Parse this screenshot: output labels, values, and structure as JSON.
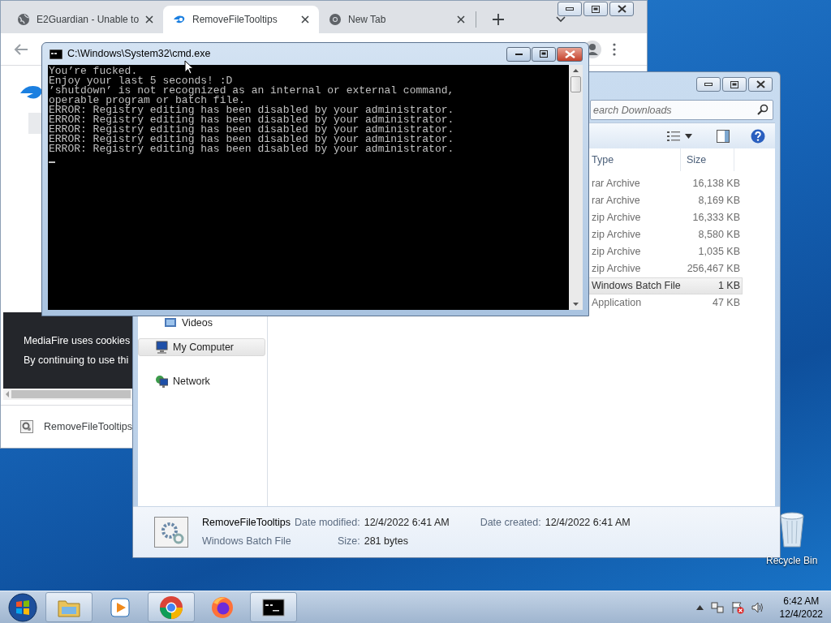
{
  "browser": {
    "tabs": [
      {
        "title": "E2Guardian - Unable to",
        "kind": "globe",
        "selected": false
      },
      {
        "title": "RemoveFileTooltips",
        "kind": "mediafire",
        "selected": true
      },
      {
        "title": "New Tab",
        "kind": "chrome",
        "selected": false
      }
    ],
    "cookie_banner": [
      "MediaFire uses cookies",
      "By continuing to use thi"
    ],
    "download_item": "RemoveFileTooltips"
  },
  "explorer": {
    "search": {
      "placeholder": "earch Downloads"
    },
    "nav_items": [
      {
        "label": "Videos",
        "kind": "library",
        "selected": false
      },
      {
        "label": "My Computer",
        "kind": "computer",
        "selected": true
      },
      {
        "label": "Network",
        "kind": "network",
        "selected": false
      }
    ],
    "columns": [
      "Type",
      "Size"
    ],
    "rows": [
      {
        "type": "rar Archive",
        "size": "16,138 KB",
        "selected": false
      },
      {
        "type": "rar Archive",
        "size": "8,169 KB",
        "selected": false
      },
      {
        "type": "zip Archive",
        "size": "16,333 KB",
        "selected": false
      },
      {
        "type": "zip Archive",
        "size": "8,580 KB",
        "selected": false
      },
      {
        "type": "zip Archive",
        "size": "1,035 KB",
        "selected": false
      },
      {
        "type": "zip Archive",
        "size": "256,467 KB",
        "selected": false
      },
      {
        "type": "Windows Batch File",
        "size": "1 KB",
        "selected": true
      },
      {
        "type": "Application",
        "size": "47 KB",
        "selected": false
      }
    ],
    "details": {
      "name": "RemoveFileTooltips",
      "type": "Windows Batch File",
      "fields": [
        {
          "label": "Date modified:",
          "value": "12/4/2022 6:41 AM"
        },
        {
          "label": "Date created:",
          "value": "12/4/2022 6:41 AM"
        },
        {
          "label": "Size:",
          "value": "281 bytes"
        }
      ]
    }
  },
  "cmd": {
    "title": "C:\\Windows\\System32\\cmd.exe",
    "lines": [
      "You’re fucked.",
      "Enjoy your last 5 seconds! :D",
      "’shutdown’ is not recognized as an internal or external command,",
      "operable program or batch file.",
      "ERROR: Registry editing has been disabled by your administrator.",
      "ERROR: Registry editing has been disabled by your administrator.",
      "ERROR: Registry editing has been disabled by your administrator.",
      "ERROR: Registry editing has been disabled by your administrator.",
      "ERROR: Registry editing has been disabled by your administrator."
    ]
  },
  "desktop": {
    "recycle_bin": "Recycle Bin"
  },
  "taskbar": {
    "buttons": [
      {
        "kind": "explorer",
        "running": true
      },
      {
        "kind": "media-player",
        "running": false
      },
      {
        "kind": "chrome",
        "running": true
      },
      {
        "kind": "firefox",
        "running": false
      },
      {
        "kind": "cmd",
        "running": true
      }
    ],
    "time": "6:42 AM",
    "date": "12/4/2022"
  }
}
